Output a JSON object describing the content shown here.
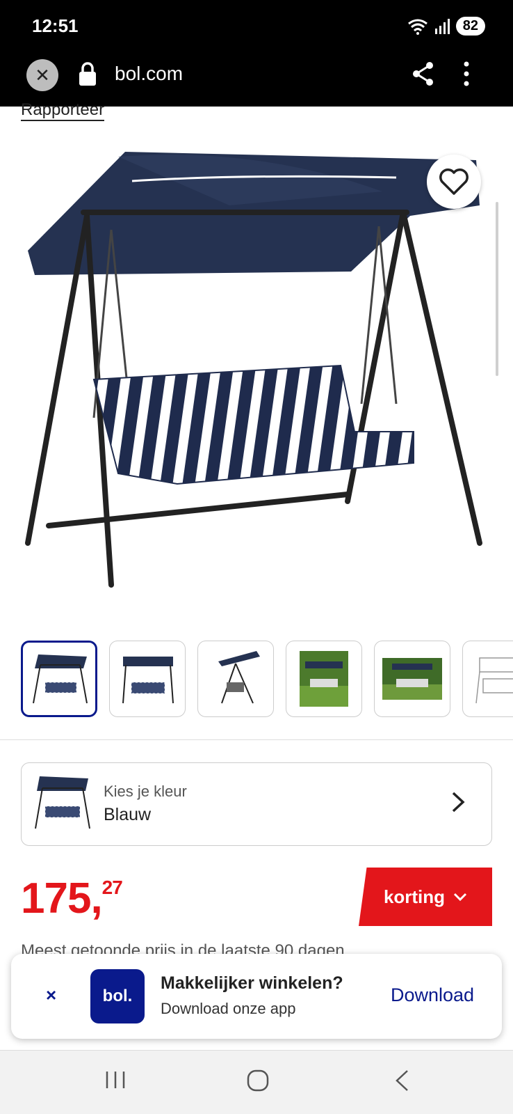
{
  "status_bar": {
    "time": "12:51",
    "battery": "82"
  },
  "browser": {
    "url": "bol.com"
  },
  "report_link": "Rapporteer",
  "color_selector": {
    "label": "Kies je kleur",
    "value": "Blauw"
  },
  "price": {
    "whole": "175,",
    "cents": "27"
  },
  "discount_button": "korting",
  "lowest_price_note": "Meest getoonde prijs in de laatste 90 dagen",
  "app_banner": {
    "close": "×",
    "logo": "bol.",
    "title": "Makkelijker winkelen?",
    "subtitle": "Download onze app",
    "cta": "Download"
  },
  "colors": {
    "brand_blue": "#0a1a8c",
    "price_red": "#e3161b"
  }
}
